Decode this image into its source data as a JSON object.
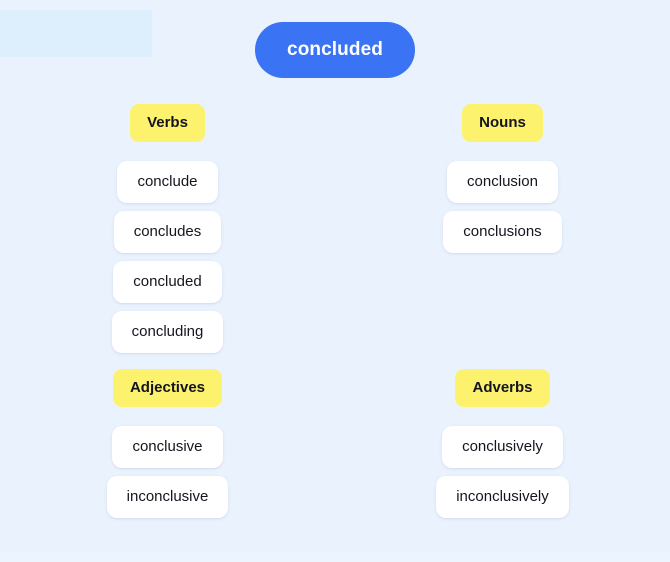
{
  "headword": {
    "label": "concluded",
    "pill_color": "#3b73f5",
    "text_color": "#ffffff"
  },
  "theme": {
    "background": "#eaf2fd",
    "badge_color": "#fcf26e",
    "card_color": "#ffffff",
    "text_color": "#15151f",
    "corner_block_color": "#ddeefc"
  },
  "groups": [
    {
      "label": "Verbs",
      "words": [
        "conclude",
        "concludes",
        "concluded",
        "concluding"
      ]
    },
    {
      "label": "Nouns",
      "words": [
        "conclusion",
        "conclusions"
      ]
    },
    {
      "label": "Adjectives",
      "words": [
        "conclusive",
        "inconclusive"
      ]
    },
    {
      "label": "Adverbs",
      "words": [
        "conclusively",
        "inconclusively"
      ]
    }
  ]
}
